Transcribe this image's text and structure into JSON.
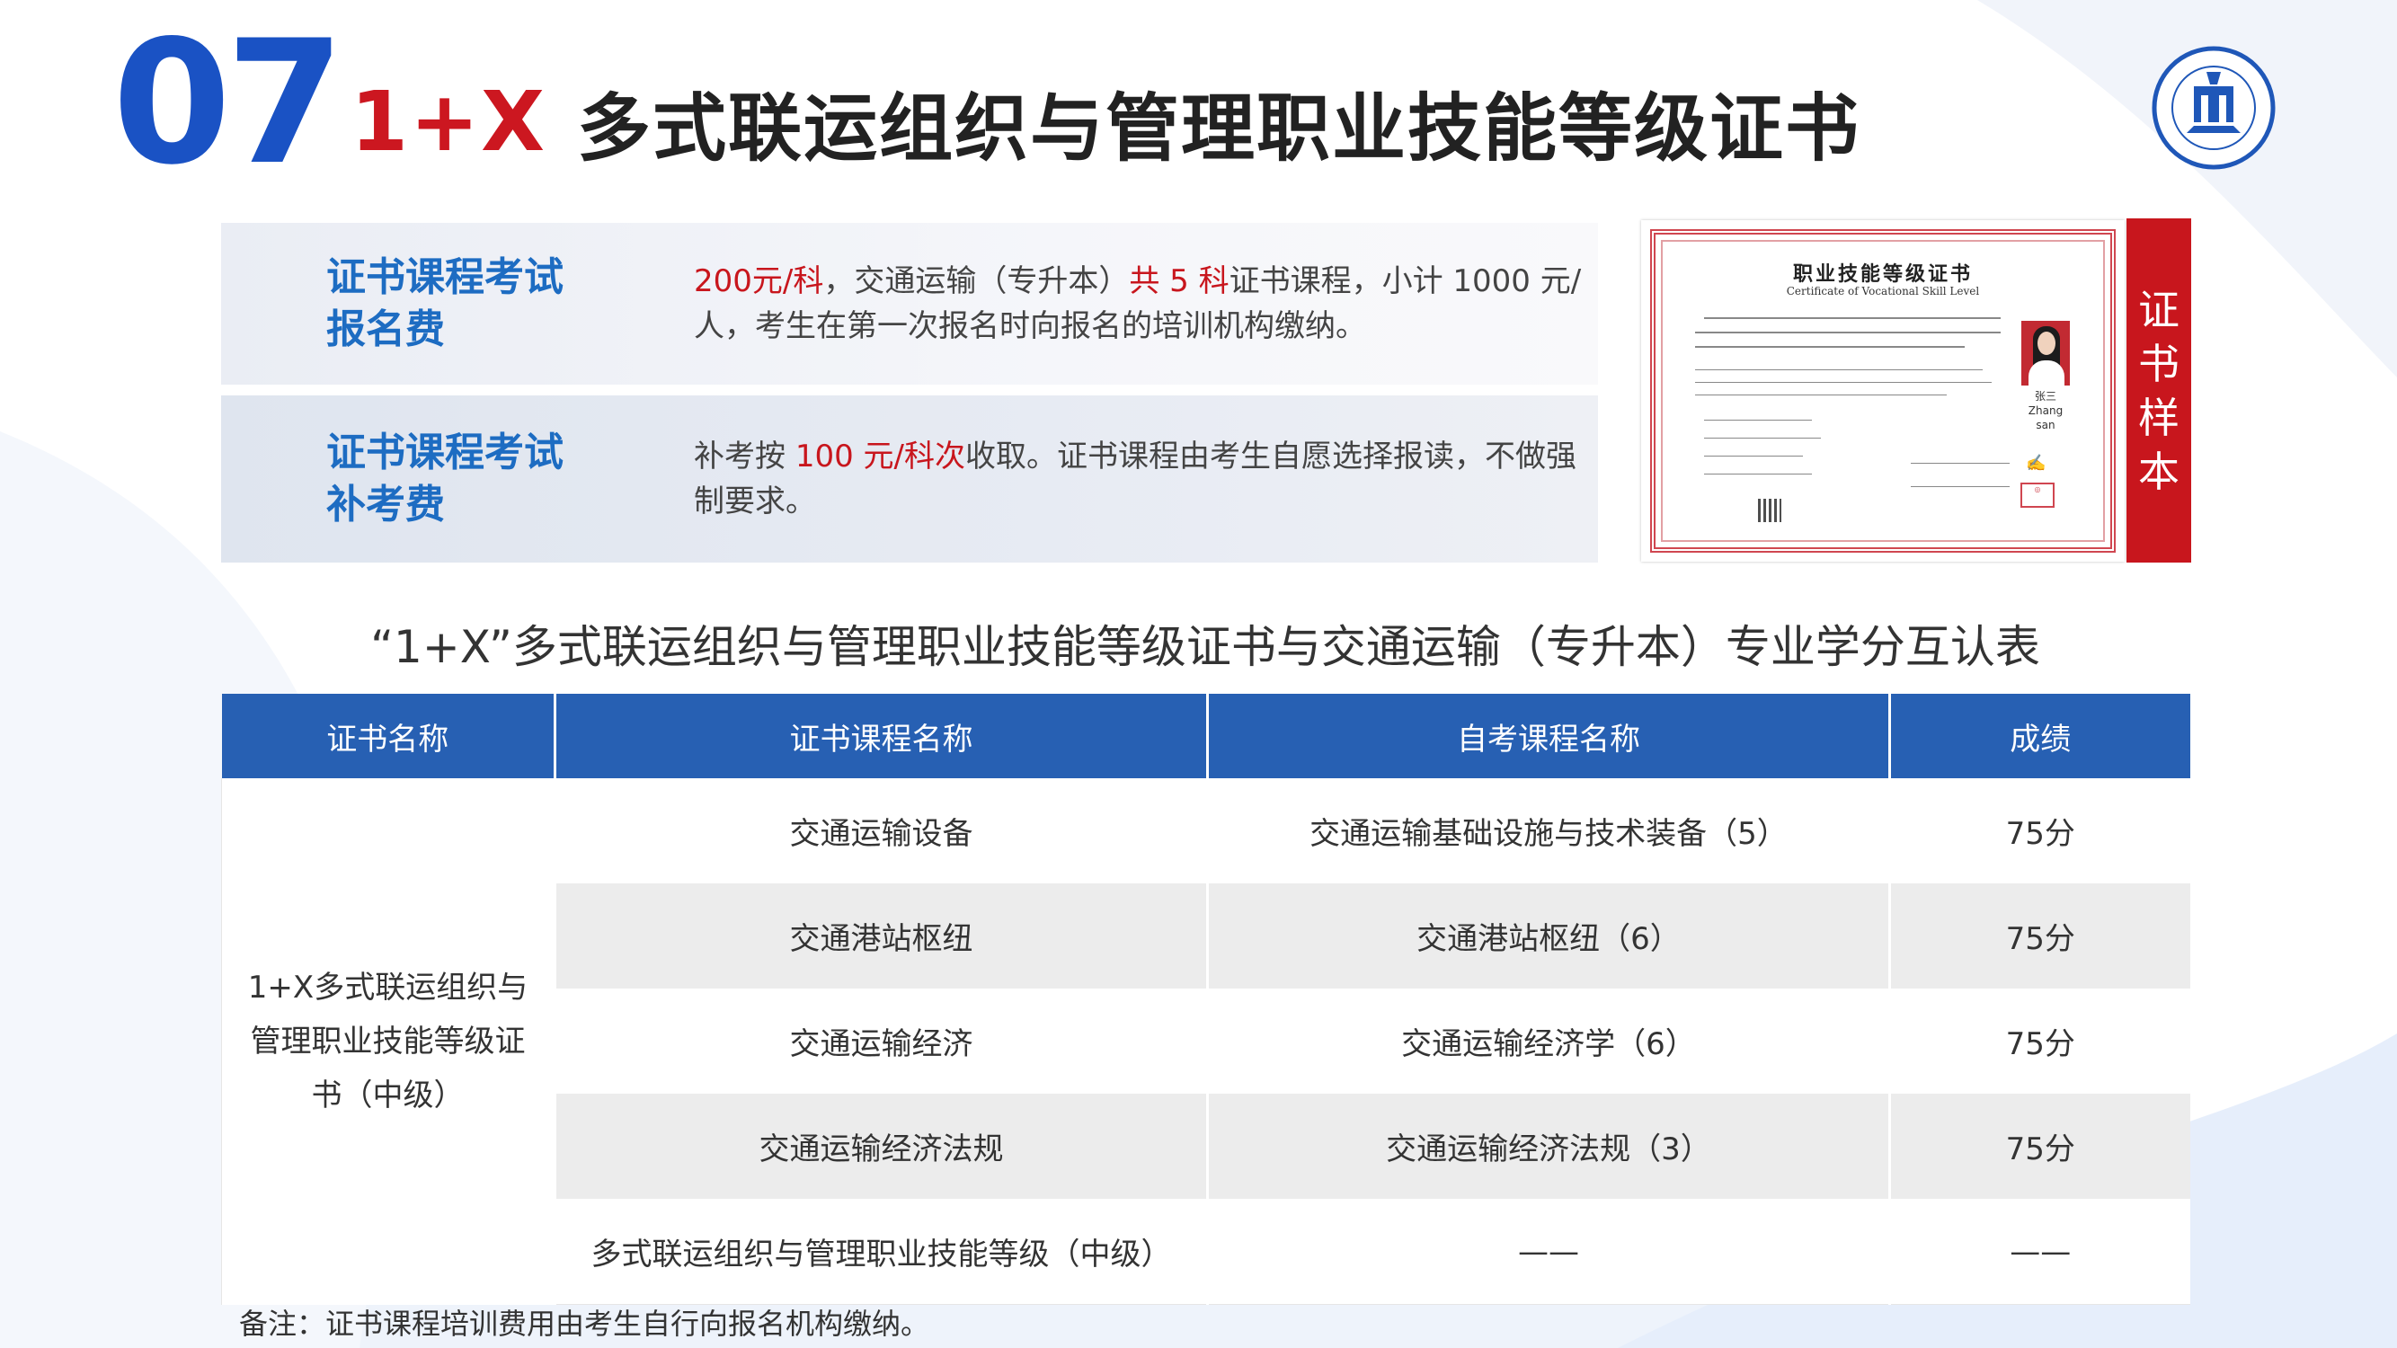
{
  "section_number": "07",
  "title": {
    "prefix": "1+X",
    "main": "多式联运组织与管理职业技能等级证书"
  },
  "logo": {
    "icon": "university-seal-icon"
  },
  "fees": [
    {
      "label_line1": "证书课程考试",
      "label_line2": "报名费",
      "text_parts": [
        {
          "text": "200元/科",
          "style": "red"
        },
        {
          "text": "，交通运输（专升本）",
          "style": "normal"
        },
        {
          "text": "共 5 科",
          "style": "red"
        },
        {
          "text": "证书课程，小计 1000 元/人，考生在第一次报名时向报名的培训机构缴纳。",
          "style": "normal"
        }
      ]
    },
    {
      "label_line1": "证书课程考试",
      "label_line2": "补考费",
      "text_parts": [
        {
          "text": "补考按 ",
          "style": "normal"
        },
        {
          "text": "100 元/科次",
          "style": "red"
        },
        {
          "text": "收取。证书课程由考生自愿选择报读，不做强制要求。",
          "style": "normal"
        }
      ]
    }
  ],
  "certificate_sample": {
    "badge": "证书样本",
    "title": "职业技能等级证书",
    "subtitle": "Certificate of Vocational Skill Level",
    "holder_name": "张三",
    "holder_name_en": "Zhang san"
  },
  "table": {
    "caption": "“1+X”多式联运组织与管理职业技能等级证书与交通运输（专升本）专业学分互认表",
    "headers": [
      "证书名称",
      "证书课程名称",
      "自考课程名称",
      "成绩"
    ],
    "certificate_name": "1+X多式联运组织与管理职业技能等级证书（中级）",
    "certificate_name_lines": [
      "1+X多式联运组织与",
      "管理职业技能等级证",
      "书（中级）"
    ],
    "rows": [
      {
        "course": "交通运输设备",
        "exam_course": "交通运输基础设施与技术装备（5）",
        "score": "75分"
      },
      {
        "course": "交通港站枢纽",
        "exam_course": "交通港站枢纽（6）",
        "score": "75分"
      },
      {
        "course": "交通运输经济",
        "exam_course": "交通运输经济学（6）",
        "score": "75分"
      },
      {
        "course": "交通运输经济法规",
        "exam_course": "交通运输经济法规（3）",
        "score": "75分"
      },
      {
        "course": "多式联运组织与管理职业技能等级（中级）",
        "exam_course": "——",
        "score": "——"
      }
    ]
  },
  "footnote": "备注：证书课程培训费用由考生自行向报名机构缴纳。"
}
